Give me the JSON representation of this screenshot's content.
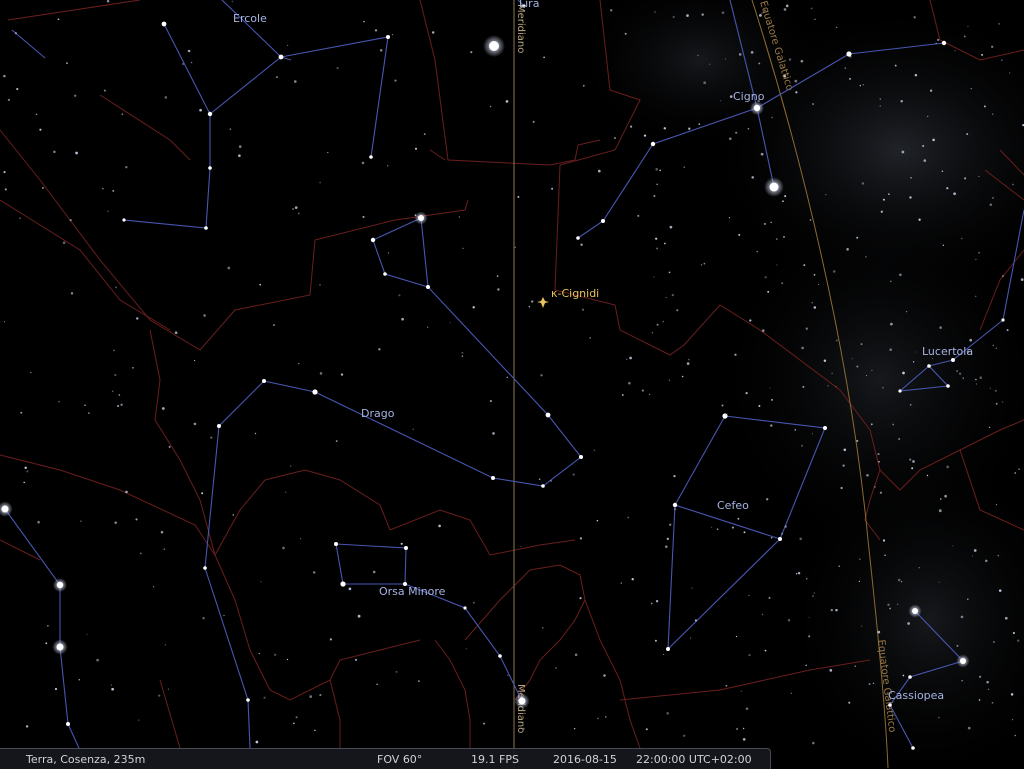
{
  "sky": {
    "constellations": [
      {
        "id": "ercole",
        "label": "Ercole"
      },
      {
        "id": "lira",
        "label": "Lira"
      },
      {
        "id": "cigno",
        "label": "Cigno"
      },
      {
        "id": "drago",
        "label": "Drago"
      },
      {
        "id": "cefeo",
        "label": "Cefeo"
      },
      {
        "id": "lucertola",
        "label": "Lucertola"
      },
      {
        "id": "orsa-minore",
        "label": "Orsa Minore"
      },
      {
        "id": "cassiopea",
        "label": "Cassiopea"
      }
    ],
    "lines": {
      "meridian": "Meridiano",
      "galactic_equator": "Equatore Galattico"
    },
    "meteor_shower": {
      "label": "κ-Cignidi",
      "color": "#e8c35a"
    },
    "colors": {
      "background": "#000000",
      "constellation_lines": "#4856b0",
      "boundaries": "#6a1e1e",
      "meridian": "#8a7a52",
      "galactic_equator": "#8a6a32",
      "labels": "#a6b4e2"
    }
  },
  "statusbar": {
    "location": "Terra, Cosenza, 235m",
    "fov": "FOV 60°",
    "fps": "19.1 FPS",
    "date": "2016-08-15",
    "time": "22:00:00 UTC+02:00"
  }
}
